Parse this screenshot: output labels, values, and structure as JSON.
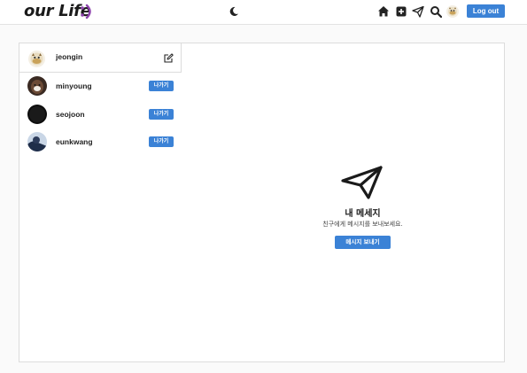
{
  "header": {
    "logo_text": "our Life",
    "logout_label": "Log out",
    "icons": [
      "theme-moon-icon",
      "home-icon",
      "new-post-icon",
      "direct-message-icon",
      "search-icon",
      "profile-avatar"
    ]
  },
  "sidebar": {
    "me": {
      "username": "jeongin"
    },
    "friends": [
      {
        "username": "minyoung",
        "action_label": "나가기"
      },
      {
        "username": "seojoon",
        "action_label": "나가기"
      },
      {
        "username": "eunkwang",
        "action_label": "나가기"
      }
    ]
  },
  "main": {
    "title": "내 메세지",
    "subtitle": "친구에게 메시지를 보내보세요.",
    "send_label": "메시지 보내기"
  },
  "colors": {
    "accent": "#3b82d6",
    "logo_smile": "#8e44ad"
  }
}
